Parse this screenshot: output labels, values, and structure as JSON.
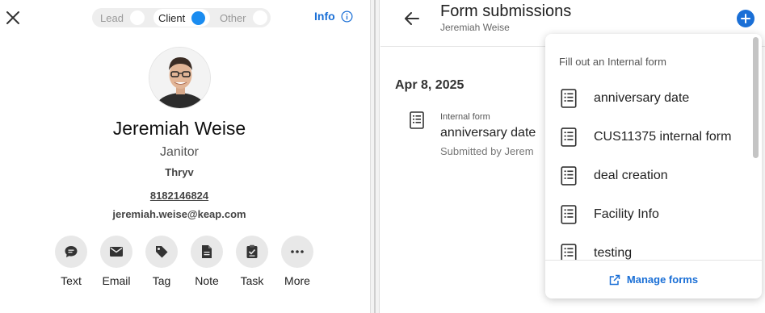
{
  "contact": {
    "stages": {
      "lead": "Lead",
      "client": "Client",
      "other": "Other",
      "active": "Client"
    },
    "info_label": "Info",
    "name": "Jeremiah Weise",
    "job_title": "Janitor",
    "company": "Thryv",
    "phone": "8182146824",
    "email": "jeremiah.weise@keap.com",
    "actions": [
      {
        "label": "Text",
        "icon": "chat-bubble-icon"
      },
      {
        "label": "Email",
        "icon": "envelope-icon"
      },
      {
        "label": "Tag",
        "icon": "tag-icon"
      },
      {
        "label": "Note",
        "icon": "note-icon"
      },
      {
        "label": "Task",
        "icon": "task-icon"
      },
      {
        "label": "More",
        "icon": "more-dots-icon"
      }
    ]
  },
  "form_panel": {
    "title": "Form submissions",
    "subtitle": "Jeremiah Weise",
    "date": "Apr 8, 2025",
    "submission": {
      "type": "Internal form",
      "name": "anniversary date",
      "submitted_by": "Submitted by Jerem"
    }
  },
  "dropdown": {
    "heading": "Fill out an Internal form",
    "items": [
      {
        "label": "anniversary date"
      },
      {
        "label": "CUS11375 internal form"
      },
      {
        "label": "deal creation"
      },
      {
        "label": "Facility Info"
      },
      {
        "label": "testing"
      }
    ],
    "manage_label": "Manage forms"
  },
  "colors": {
    "accent": "#1a6fd6",
    "toggle_active": "#1a8cf0"
  }
}
